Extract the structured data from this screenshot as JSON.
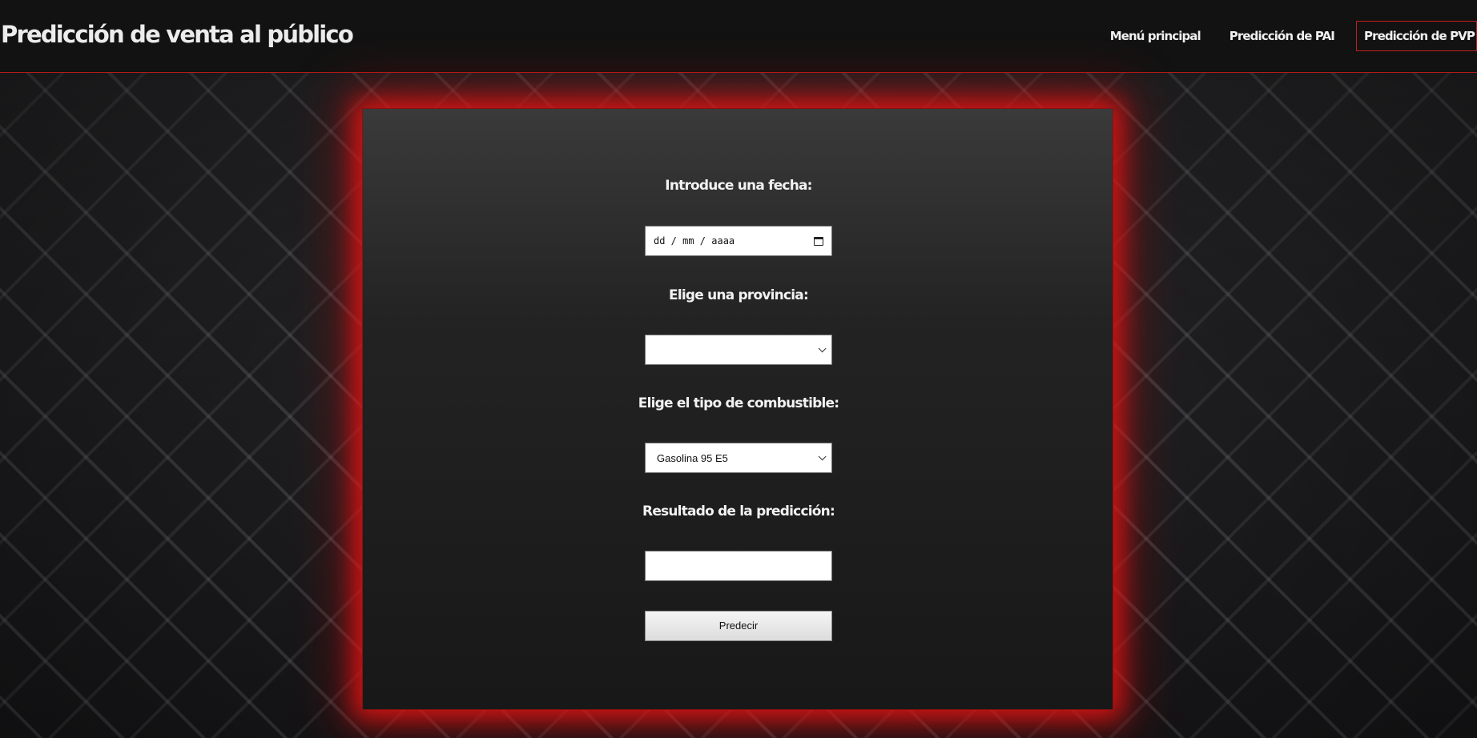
{
  "header": {
    "title": "Predicción de venta al público",
    "nav": [
      {
        "label": "Menú principal"
      },
      {
        "label": "Predicción de PAI"
      },
      {
        "label": "Predicción de PVP"
      }
    ]
  },
  "form": {
    "date_label": "Introduce una fecha:",
    "date_placeholder": "dd / mm / aaaa",
    "province_label": "Elige una provincia:",
    "province_value": "",
    "fuel_label": "Elige el tipo de combustible:",
    "fuel_value": "Gasolina 95 E5",
    "result_label": "Resultado de la predicción:",
    "result_value": "",
    "submit_label": "Predecir"
  },
  "colors": {
    "accent": "#c41e1e",
    "header_bg": "#121212",
    "panel_glow": "#e61414"
  },
  "icons": {
    "date": "calendar-icon",
    "select": "chevron-down-icon"
  }
}
